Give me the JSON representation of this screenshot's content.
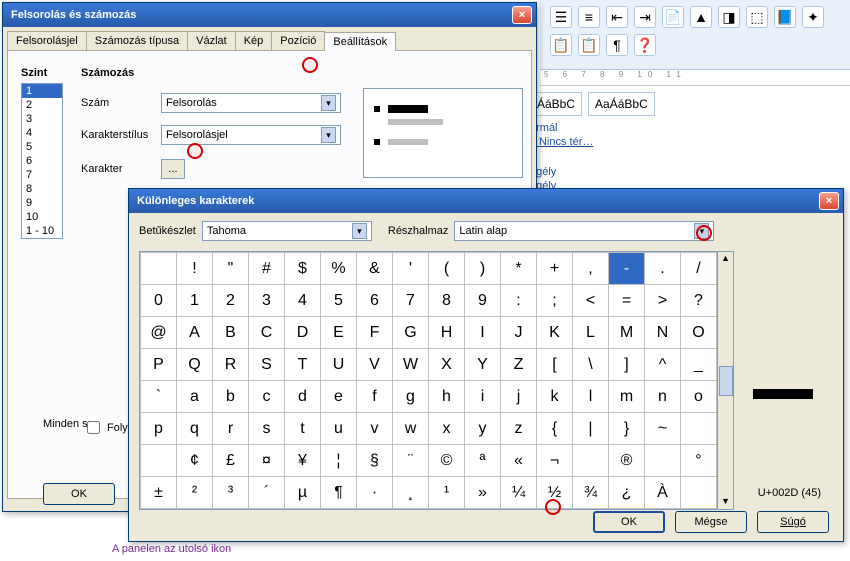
{
  "toolbar": {
    "icons": [
      "☰",
      "≡",
      "⇤",
      "⇥",
      "📄",
      "▲",
      "◨",
      "⬚",
      "📘",
      "✦",
      "📋",
      "📋",
      "¶",
      "❓"
    ]
  },
  "ruler_text": "5 6 7 8 9 10 11",
  "styles": {
    "sample1": "ÁáBbC",
    "sample2": "AaÁáBbC",
    "label1": "ormál",
    "label2": "¶ Nincs tér…",
    "link1": "egély",
    "link2": "egély"
  },
  "dlg1": {
    "title": "Felsorolás és számozás",
    "tabs": [
      "Felsorolásjel",
      "Számozás típusa",
      "Vázlat",
      "Kép",
      "Pozíció",
      "Beállítások"
    ],
    "active_tab": 5,
    "szint": "Szint",
    "szamozas": "Számozás",
    "levels": [
      "1",
      "2",
      "3",
      "4",
      "5",
      "6",
      "7",
      "8",
      "9",
      "10",
      "1 - 10"
    ],
    "szam_label": "Szám",
    "szam_value": "Felsorolás",
    "kstilus_label": "Karakterstílus",
    "kstilus_value": "Felsorolásjel",
    "karakter_label": "Karakter",
    "karakter_btn": "...",
    "minden": "Minden sz",
    "folyt": "Folya",
    "ok": "OK"
  },
  "dlg2": {
    "title": "Különleges karakterek",
    "font_label": "Betűkészlet",
    "font_value": "Tahoma",
    "subset_label": "Részhalmaz",
    "subset_value": "Latin alap",
    "rows": [
      [
        "",
        "!",
        "\"",
        "#",
        "$",
        "%",
        "&",
        "'",
        "(",
        ")",
        "*",
        "+",
        ",",
        "-",
        ".",
        "/"
      ],
      [
        "0",
        "1",
        "2",
        "3",
        "4",
        "5",
        "6",
        "7",
        "8",
        "9",
        ":",
        ";",
        "<",
        "=",
        ">",
        "?"
      ],
      [
        "@",
        "A",
        "B",
        "C",
        "D",
        "E",
        "F",
        "G",
        "H",
        "I",
        "J",
        "K",
        "L",
        "M",
        "N",
        "O"
      ],
      [
        "P",
        "Q",
        "R",
        "S",
        "T",
        "U",
        "V",
        "W",
        "X",
        "Y",
        "Z",
        "[",
        "\\",
        "]",
        "^",
        "_"
      ],
      [
        "`",
        "a",
        "b",
        "c",
        "d",
        "e",
        "f",
        "g",
        "h",
        "i",
        "j",
        "k",
        "l",
        "m",
        "n",
        "o"
      ],
      [
        "p",
        "q",
        "r",
        "s",
        "t",
        "u",
        "v",
        "w",
        "x",
        "y",
        "z",
        "{",
        "|",
        "}",
        "~",
        ""
      ],
      [
        "",
        "¢",
        "£",
        "¤",
        "¥",
        "¦",
        "§",
        "¨",
        "©",
        "ª",
        "«",
        "¬",
        "",
        "®",
        "",
        "°"
      ],
      [
        "±",
        "²",
        "³",
        "´",
        "µ",
        "¶",
        "·",
        "¸",
        "¹",
        "»",
        "¼",
        "½",
        "¾",
        "¿",
        "À",
        ""
      ]
    ],
    "selected": "-",
    "codepoint": "U+002D (45)",
    "ok": "OK",
    "cancel": "Mégse",
    "help": "Súgó"
  },
  "bottom_text": "A panelen az utolsó ikon"
}
